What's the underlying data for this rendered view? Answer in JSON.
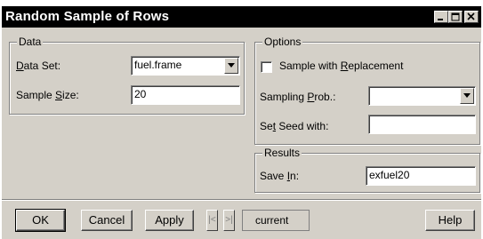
{
  "window": {
    "title": "Random Sample of Rows",
    "controls": [
      "minimize",
      "maximize",
      "close"
    ]
  },
  "data_group": {
    "legend": "Data",
    "data_set_label_pre": "",
    "data_set_label_u": "D",
    "data_set_label_post": "ata Set:",
    "data_set_value": "fuel.frame",
    "sample_size_label_pre": "Sample ",
    "sample_size_label_u": "S",
    "sample_size_label_post": "ize:",
    "sample_size_value": "20"
  },
  "options_group": {
    "legend": "Options",
    "replacement_label_pre": "Sample with ",
    "replacement_label_u": "R",
    "replacement_label_post": "eplacement",
    "replacement_checked": false,
    "sampling_prob_label_pre": "Sampling ",
    "sampling_prob_label_u": "P",
    "sampling_prob_label_post": "rob.:",
    "sampling_prob_value": "",
    "seed_label_pre": "Se",
    "seed_label_u": "t",
    "seed_label_post": " Seed with:",
    "seed_value": ""
  },
  "results_group": {
    "legend": "Results",
    "save_in_label_pre": "Save ",
    "save_in_label_u": "I",
    "save_in_label_post": "n:",
    "save_in_value": "exfuel20"
  },
  "buttons": {
    "ok": "OK",
    "cancel": "Cancel",
    "apply": "Apply",
    "prev": "|<",
    "next": ">|",
    "current": "current",
    "help": "Help"
  }
}
